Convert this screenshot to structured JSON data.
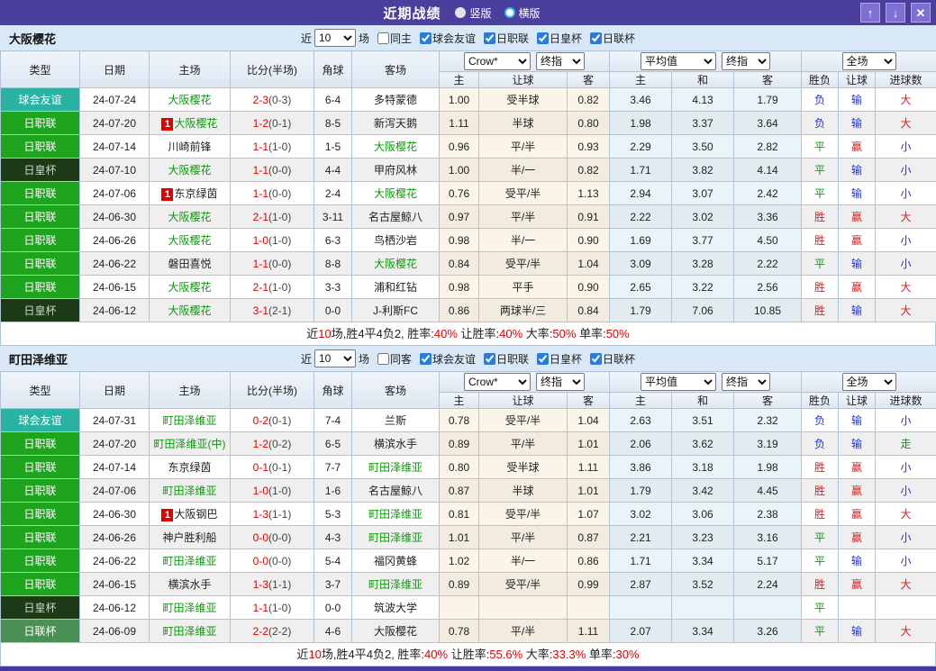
{
  "titlebar": {
    "title": "近期战绩",
    "radio_vertical": "竖版",
    "radio_horizontal": "横版",
    "bg_color": "#4a3f9c"
  },
  "controls": {
    "crow_select": "Crow*",
    "final_select": "终指",
    "avg_select": "平均值",
    "full_select": "全场"
  },
  "table_header": {
    "cols": [
      "类型",
      "日期",
      "主场",
      "比分(半场)",
      "角球",
      "客场"
    ],
    "sub": [
      "主",
      "让球",
      "客",
      "主",
      "和",
      "客",
      "胜负",
      "让球",
      "进球数"
    ]
  },
  "colors": {
    "win_red": "#d42222",
    "draw_green": "#0a9a0a",
    "lose_blue": "#2233cc",
    "score_red": "#dd0000",
    "team_green": "#0a9a0a"
  },
  "sections": [
    {
      "team": "大阪樱花",
      "near_label": "近",
      "count": "10",
      "games_label": "场",
      "same_label": "同主",
      "same_checked": false,
      "leagues": [
        {
          "label": "球会友谊",
          "checked": true
        },
        {
          "label": "日职联",
          "checked": true
        },
        {
          "label": "日皇杯",
          "checked": true
        },
        {
          "label": "日联杯",
          "checked": true
        }
      ],
      "rows": [
        {
          "type": "球会友谊",
          "tc": "friendly",
          "date": "24-07-24",
          "home": "大阪樱花",
          "hg": true,
          "hb": false,
          "score": "2-3",
          "half": "(0-3)",
          "corner": "6-4",
          "away": "多特蒙德",
          "ag": false,
          "o1": "1.00",
          "o2": "受半球",
          "o3": "0.82",
          "a1": "3.46",
          "a2": "4.13",
          "a3": "1.79",
          "r": "负",
          "rc": "b",
          "h": "输",
          "hc": "b",
          "g": "大",
          "gc": "r"
        },
        {
          "type": "日职联",
          "tc": "jl",
          "date": "24-07-20",
          "home": "大阪樱花",
          "hg": true,
          "hb": true,
          "score": "1-2",
          "half": "(0-1)",
          "corner": "8-5",
          "away": "新泻天鹅",
          "ag": false,
          "o1": "1.11",
          "o2": "半球",
          "o3": "0.80",
          "a1": "1.98",
          "a2": "3.37",
          "a3": "3.64",
          "r": "负",
          "rc": "b",
          "h": "输",
          "hc": "b",
          "g": "大",
          "gc": "r"
        },
        {
          "type": "日职联",
          "tc": "jl",
          "date": "24-07-14",
          "home": "川崎前锋",
          "hg": false,
          "hb": false,
          "score": "1-1",
          "half": "(1-0)",
          "corner": "1-5",
          "away": "大阪樱花",
          "ag": true,
          "o1": "0.96",
          "o2": "平/半",
          "o3": "0.93",
          "a1": "2.29",
          "a2": "3.50",
          "a3": "2.82",
          "r": "平",
          "rc": "g",
          "h": "赢",
          "hc": "r",
          "g": "小",
          "gc": "b"
        },
        {
          "type": "日皇杯",
          "tc": "ec",
          "date": "24-07-10",
          "home": "大阪樱花",
          "hg": true,
          "hb": false,
          "score": "1-1",
          "half": "(0-0)",
          "corner": "4-4",
          "away": "甲府风林",
          "ag": false,
          "o1": "1.00",
          "o2": "半/一",
          "o3": "0.82",
          "a1": "1.71",
          "a2": "3.82",
          "a3": "4.14",
          "r": "平",
          "rc": "g",
          "h": "输",
          "hc": "b",
          "g": "小",
          "gc": "b"
        },
        {
          "type": "日职联",
          "tc": "jl",
          "date": "24-07-06",
          "home": "东京绿茵",
          "hg": false,
          "hb": true,
          "score": "1-1",
          "half": "(0-0)",
          "corner": "2-4",
          "away": "大阪樱花",
          "ag": true,
          "o1": "0.76",
          "o2": "受平/半",
          "o3": "1.13",
          "a1": "2.94",
          "a2": "3.07",
          "a3": "2.42",
          "r": "平",
          "rc": "g",
          "h": "输",
          "hc": "b",
          "g": "小",
          "gc": "b"
        },
        {
          "type": "日职联",
          "tc": "jl",
          "date": "24-06-30",
          "home": "大阪樱花",
          "hg": true,
          "hb": false,
          "score": "2-1",
          "half": "(1-0)",
          "corner": "3-11",
          "away": "名古屋鲸八",
          "ag": false,
          "o1": "0.97",
          "o2": "平/半",
          "o3": "0.91",
          "a1": "2.22",
          "a2": "3.02",
          "a3": "3.36",
          "r": "胜",
          "rc": "r",
          "h": "赢",
          "hc": "r",
          "g": "大",
          "gc": "r"
        },
        {
          "type": "日职联",
          "tc": "jl",
          "date": "24-06-26",
          "home": "大阪樱花",
          "hg": true,
          "hb": false,
          "score": "1-0",
          "half": "(1-0)",
          "corner": "6-3",
          "away": "鸟栖沙岩",
          "ag": false,
          "o1": "0.98",
          "o2": "半/一",
          "o3": "0.90",
          "a1": "1.69",
          "a2": "3.77",
          "a3": "4.50",
          "r": "胜",
          "rc": "r",
          "h": "赢",
          "hc": "r",
          "g": "小",
          "gc": "b"
        },
        {
          "type": "日职联",
          "tc": "jl",
          "date": "24-06-22",
          "home": "磐田喜悦",
          "hg": false,
          "hb": false,
          "score": "1-1",
          "half": "(0-0)",
          "corner": "8-8",
          "away": "大阪樱花",
          "ag": true,
          "o1": "0.84",
          "o2": "受平/半",
          "o3": "1.04",
          "a1": "3.09",
          "a2": "3.28",
          "a3": "2.22",
          "r": "平",
          "rc": "g",
          "h": "输",
          "hc": "b",
          "g": "小",
          "gc": "b"
        },
        {
          "type": "日职联",
          "tc": "jl",
          "date": "24-06-15",
          "home": "大阪樱花",
          "hg": true,
          "hb": false,
          "score": "2-1",
          "half": "(1-0)",
          "corner": "3-3",
          "away": "浦和红钻",
          "ag": false,
          "o1": "0.98",
          "o2": "平手",
          "o3": "0.90",
          "a1": "2.65",
          "a2": "3.22",
          "a3": "2.56",
          "r": "胜",
          "rc": "r",
          "h": "赢",
          "hc": "r",
          "g": "大",
          "gc": "r"
        },
        {
          "type": "日皇杯",
          "tc": "ec",
          "date": "24-06-12",
          "home": "大阪樱花",
          "hg": true,
          "hb": false,
          "score": "3-1",
          "half": "(2-1)",
          "corner": "0-0",
          "away": "J-利斯FC",
          "ag": false,
          "o1": "0.86",
          "o2": "两球半/三",
          "o3": "0.84",
          "a1": "1.79",
          "a2": "7.06",
          "a3": "10.85",
          "r": "胜",
          "rc": "r",
          "h": "输",
          "hc": "b",
          "g": "大",
          "gc": "r"
        }
      ],
      "summary": [
        [
          "近",
          0
        ],
        [
          "10",
          1
        ],
        [
          "场,胜4平4负2, 胜率:",
          0
        ],
        [
          "40%",
          1
        ],
        [
          " 让胜率:",
          0
        ],
        [
          "40%",
          1
        ],
        [
          " 大率:",
          0
        ],
        [
          "50%",
          1
        ],
        [
          " 单率:",
          0
        ],
        [
          "50%",
          1
        ]
      ]
    },
    {
      "team": "町田泽维亚",
      "near_label": "近",
      "count": "10",
      "games_label": "场",
      "same_label": "同客",
      "same_checked": false,
      "leagues": [
        {
          "label": "球会友谊",
          "checked": true
        },
        {
          "label": "日职联",
          "checked": true
        },
        {
          "label": "日皇杯",
          "checked": true
        },
        {
          "label": "日联杯",
          "checked": true
        }
      ],
      "rows": [
        {
          "type": "球会友谊",
          "tc": "friendly",
          "date": "24-07-31",
          "home": "町田泽维亚",
          "hg": true,
          "hb": false,
          "score": "0-2",
          "half": "(0-1)",
          "corner": "7-4",
          "away": "兰斯",
          "ag": false,
          "o1": "0.78",
          "o2": "受平/半",
          "o3": "1.04",
          "a1": "2.63",
          "a2": "3.51",
          "a3": "2.32",
          "r": "负",
          "rc": "b",
          "h": "输",
          "hc": "b",
          "g": "小",
          "gc": "b"
        },
        {
          "type": "日职联",
          "tc": "jl",
          "date": "24-07-20",
          "home": "町田泽维亚(中)",
          "hg": true,
          "hb": false,
          "score": "1-2",
          "half": "(0-2)",
          "corner": "6-5",
          "away": "横滨水手",
          "ag": false,
          "o1": "0.89",
          "o2": "平/半",
          "o3": "1.01",
          "a1": "2.06",
          "a2": "3.62",
          "a3": "3.19",
          "r": "负",
          "rc": "b",
          "h": "输",
          "hc": "b",
          "g": "走",
          "gc": "g"
        },
        {
          "type": "日职联",
          "tc": "jl",
          "date": "24-07-14",
          "home": "东京绿茵",
          "hg": false,
          "hb": false,
          "score": "0-1",
          "half": "(0-1)",
          "corner": "7-7",
          "away": "町田泽维亚",
          "ag": true,
          "o1": "0.80",
          "o2": "受半球",
          "o3": "1.11",
          "a1": "3.86",
          "a2": "3.18",
          "a3": "1.98",
          "r": "胜",
          "rc": "r",
          "h": "赢",
          "hc": "r",
          "g": "小",
          "gc": "b"
        },
        {
          "type": "日职联",
          "tc": "jl",
          "date": "24-07-06",
          "home": "町田泽维亚",
          "hg": true,
          "hb": false,
          "score": "1-0",
          "half": "(1-0)",
          "corner": "1-6",
          "away": "名古屋鲸八",
          "ag": false,
          "o1": "0.87",
          "o2": "半球",
          "o3": "1.01",
          "a1": "1.79",
          "a2": "3.42",
          "a3": "4.45",
          "r": "胜",
          "rc": "r",
          "h": "赢",
          "hc": "r",
          "g": "小",
          "gc": "b"
        },
        {
          "type": "日职联",
          "tc": "jl",
          "date": "24-06-30",
          "home": "大阪钢巴",
          "hg": false,
          "hb": true,
          "score": "1-3",
          "half": "(1-1)",
          "corner": "5-3",
          "away": "町田泽维亚",
          "ag": true,
          "o1": "0.81",
          "o2": "受平/半",
          "o3": "1.07",
          "a1": "3.02",
          "a2": "3.06",
          "a3": "2.38",
          "r": "胜",
          "rc": "r",
          "h": "赢",
          "hc": "r",
          "g": "大",
          "gc": "r"
        },
        {
          "type": "日职联",
          "tc": "jl",
          "date": "24-06-26",
          "home": "神户胜利船",
          "hg": false,
          "hb": false,
          "score": "0-0",
          "half": "(0-0)",
          "corner": "4-3",
          "away": "町田泽维亚",
          "ag": true,
          "o1": "1.01",
          "o2": "平/半",
          "o3": "0.87",
          "a1": "2.21",
          "a2": "3.23",
          "a3": "3.16",
          "r": "平",
          "rc": "g",
          "h": "赢",
          "hc": "r",
          "g": "小",
          "gc": "b"
        },
        {
          "type": "日职联",
          "tc": "jl",
          "date": "24-06-22",
          "home": "町田泽维亚",
          "hg": true,
          "hb": false,
          "score": "0-0",
          "half": "(0-0)",
          "corner": "5-4",
          "away": "福冈黄蜂",
          "ag": false,
          "o1": "1.02",
          "o2": "半/一",
          "o3": "0.86",
          "a1": "1.71",
          "a2": "3.34",
          "a3": "5.17",
          "r": "平",
          "rc": "g",
          "h": "输",
          "hc": "b",
          "g": "小",
          "gc": "b"
        },
        {
          "type": "日职联",
          "tc": "jl",
          "date": "24-06-15",
          "home": "横滨水手",
          "hg": false,
          "hb": false,
          "score": "1-3",
          "half": "(1-1)",
          "corner": "3-7",
          "away": "町田泽维亚",
          "ag": true,
          "o1": "0.89",
          "o2": "受平/半",
          "o3": "0.99",
          "a1": "2.87",
          "a2": "3.52",
          "a3": "2.24",
          "r": "胜",
          "rc": "r",
          "h": "赢",
          "hc": "r",
          "g": "大",
          "gc": "r"
        },
        {
          "type": "日皇杯",
          "tc": "ec",
          "date": "24-06-12",
          "home": "町田泽维亚",
          "hg": true,
          "hb": false,
          "score": "1-1",
          "half": "(1-0)",
          "corner": "0-0",
          "away": "筑波大学",
          "ag": false,
          "o1": "",
          "o2": "",
          "o3": "",
          "a1": "",
          "a2": "",
          "a3": "",
          "r": "平",
          "rc": "g",
          "h": "",
          "hc": "",
          "g": "",
          "gc": ""
        },
        {
          "type": "日联杯",
          "tc": "lc",
          "date": "24-06-09",
          "home": "町田泽维亚",
          "hg": true,
          "hb": false,
          "score": "2-2",
          "half": "(2-2)",
          "corner": "4-6",
          "away": "大阪樱花",
          "ag": false,
          "o1": "0.78",
          "o2": "平/半",
          "o3": "1.11",
          "a1": "2.07",
          "a2": "3.34",
          "a3": "3.26",
          "r": "平",
          "rc": "g",
          "h": "输",
          "hc": "b",
          "g": "大",
          "gc": "r"
        }
      ],
      "summary": [
        [
          "近",
          0
        ],
        [
          "10",
          1
        ],
        [
          "场,胜4平4负2, 胜率:",
          0
        ],
        [
          "40%",
          1
        ],
        [
          " 让胜率:",
          0
        ],
        [
          "55.6%",
          1
        ],
        [
          " 大率:",
          0
        ],
        [
          "33.3%",
          1
        ],
        [
          " 单率:",
          0
        ],
        [
          "30%",
          1
        ]
      ]
    }
  ]
}
